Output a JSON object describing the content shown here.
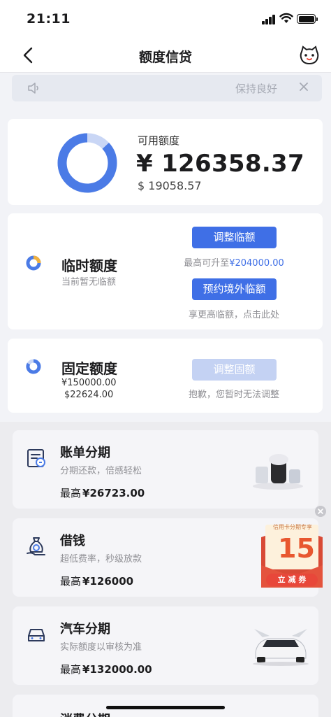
{
  "status_bar": {
    "time": "21:11"
  },
  "nav": {
    "title": "额度信贷"
  },
  "notice": {
    "text": "保持良好"
  },
  "credit": {
    "label": "可用额度",
    "amount": "¥ 126358.37",
    "sub_amount": "$ 19058.57",
    "used_ratio": 0.13,
    "colors": {
      "available": "#4b7be6",
      "used": "#c9d6f5"
    }
  },
  "temp_quota": {
    "title": "临时额度",
    "subtitle": "当前暂无临额",
    "adjust_button": "调整临额",
    "max_note_prefix": "最高可升至",
    "max_note_value": "¥204000.00",
    "overseas_button": "预约境外临额",
    "overseas_note": "享更高临额，点击此处"
  },
  "fixed_quota": {
    "title": "固定额度",
    "amount_cny": "¥150000.00",
    "amount_usd": "$22624.00",
    "adjust_button": "调整固额",
    "adjust_note": "抱歉，您暂时无法调整"
  },
  "services": [
    {
      "title": "账单分期",
      "desc": "分期还款，倍感轻松",
      "max_label": "最高",
      "max_value": "¥26723.00",
      "icon": "bill-installment-icon"
    },
    {
      "title": "借钱",
      "desc": "超低费率，秒级放款",
      "max_label": "最高",
      "max_value": "¥126000",
      "icon": "money-bag-icon"
    },
    {
      "title": "汽车分期",
      "desc": "实际额度以审核为准",
      "max_label": "最高",
      "max_value": "¥132000.00",
      "icon": "car-icon"
    },
    {
      "title": "消费分期",
      "icon": "consumer-installment-icon"
    }
  ],
  "coupon": {
    "tag": "信用卡分期专享",
    "number": "15",
    "button": "立 减 券"
  }
}
